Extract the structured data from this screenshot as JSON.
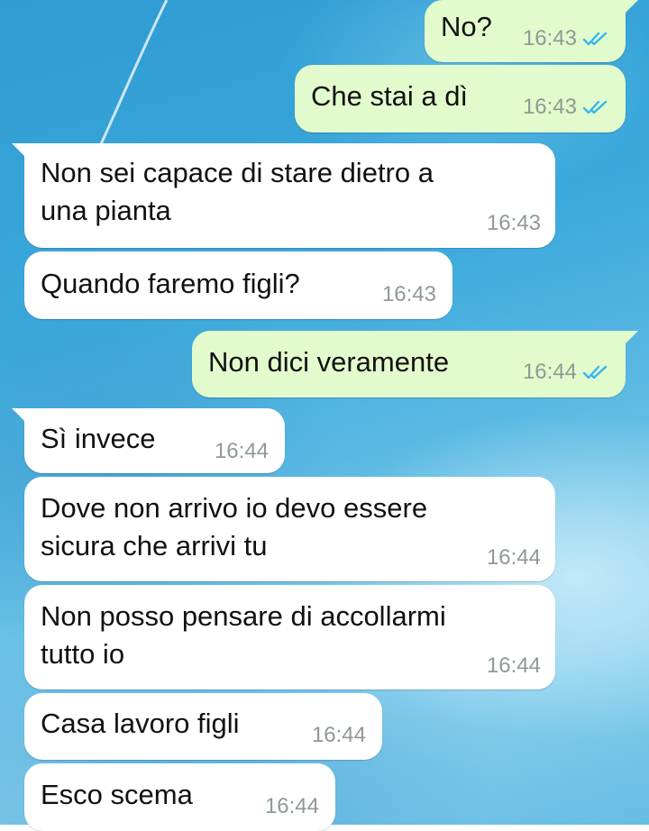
{
  "chat": {
    "messages": [
      {
        "direction": "out",
        "text": "No?",
        "time": "16:43",
        "status": "read"
      },
      {
        "direction": "out",
        "text": "Che stai a dì",
        "time": "16:43",
        "status": "read"
      },
      {
        "direction": "in",
        "text": "Non sei capace di stare dietro a\nuna pianta",
        "time": "16:43"
      },
      {
        "direction": "in",
        "text": "Quando faremo figli?",
        "time": "16:43"
      },
      {
        "direction": "out",
        "text": "Non dici veramente",
        "time": "16:44",
        "status": "read"
      },
      {
        "direction": "in",
        "text": "Sì invece",
        "time": "16:44"
      },
      {
        "direction": "in",
        "text": "Dove non arrivo io devo essere\nsicura che arrivi tu",
        "time": "16:44"
      },
      {
        "direction": "in",
        "text": "Non posso pensare di accollarmi\ntutto io",
        "time": "16:44"
      },
      {
        "direction": "in",
        "text": "Casa lavoro figli",
        "time": "16:44"
      },
      {
        "direction": "in",
        "text": "Esco scema",
        "time": "16:44"
      }
    ]
  },
  "colors": {
    "incoming_bubble": "#ffffff",
    "outgoing_bubble": "#e2fbcd",
    "read_ticks": "#34b7f1",
    "timestamp": "#8f9a94"
  },
  "icons": {
    "read_status": "double-check-icon"
  }
}
